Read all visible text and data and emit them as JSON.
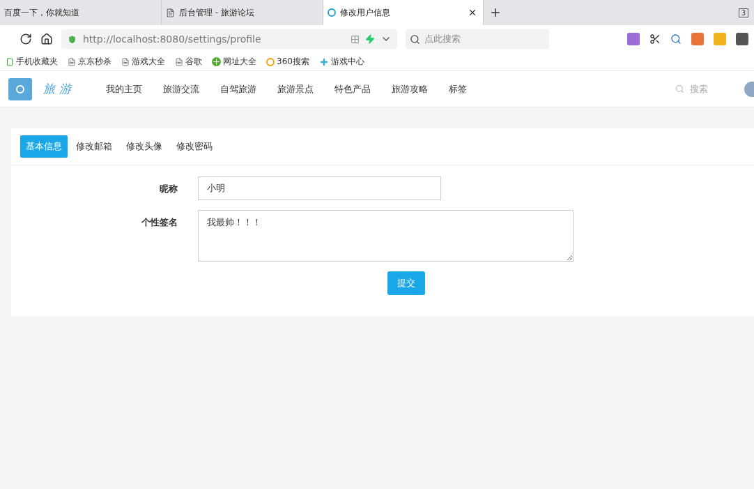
{
  "browser": {
    "tabs": [
      {
        "title": "百度一下，你就知道",
        "selected": false,
        "kind": "none"
      },
      {
        "title": "后台管理 - 旅游论坛",
        "selected": false,
        "kind": "page"
      },
      {
        "title": "修改用户信息",
        "selected": true,
        "kind": "site"
      }
    ],
    "tab_count": "3",
    "url": "http://localhost:8080/settings/profile",
    "search_placeholder": "点此搜索",
    "bookmarks": [
      {
        "label": "手机收藏夹",
        "kind": "phone"
      },
      {
        "label": "京东秒杀",
        "kind": "page"
      },
      {
        "label": "游戏大全",
        "kind": "page"
      },
      {
        "label": "谷歌",
        "kind": "page"
      },
      {
        "label": "网址大全",
        "kind": "plus"
      },
      {
        "label": "360搜索",
        "kind": "ring"
      },
      {
        "label": "游戏中心",
        "kind": "cross"
      }
    ]
  },
  "site": {
    "logo_text": "旅游",
    "nav": [
      "我的主页",
      "旅游交流",
      "自驾旅游",
      "旅游景点",
      "特色产品",
      "旅游攻略",
      "标签"
    ],
    "search_placeholder": "搜索"
  },
  "profile_tabs": [
    {
      "label": "基本信息",
      "selected": true
    },
    {
      "label": "修改邮箱",
      "selected": false
    },
    {
      "label": "修改头像",
      "selected": false
    },
    {
      "label": "修改密码",
      "selected": false
    }
  ],
  "form": {
    "nickname": {
      "label": "昵称",
      "value": "小明"
    },
    "signature": {
      "label": "个性签名",
      "value": "我最帅！！！"
    },
    "submit": "提交"
  }
}
